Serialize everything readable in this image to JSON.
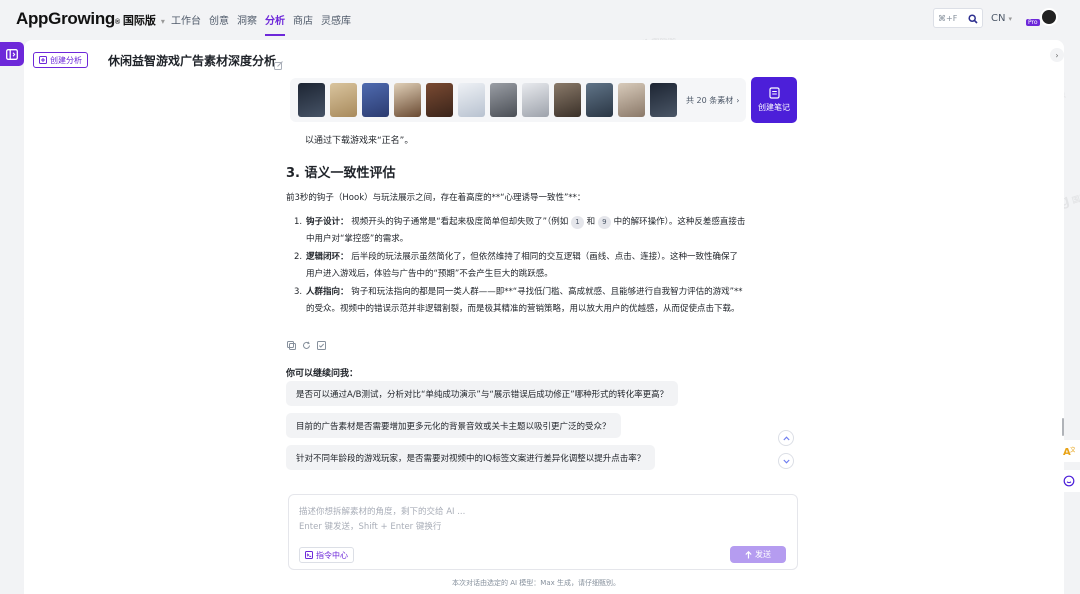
{
  "app": {
    "logo_main": "AppGrowing",
    "logo_sub": "国际版",
    "nav": [
      "工作台",
      "创意",
      "洞察",
      "分析",
      "商店",
      "灵感库"
    ],
    "active_nav": "分析",
    "shortcut": "⌘+F",
    "language": "CN",
    "plan_badge": "Pro"
  },
  "page": {
    "create_analysis": "创建分析",
    "title": "休闲益智游戏广告素材深度分析"
  },
  "media_strip": {
    "total_label": "共 20 条素材",
    "create_note": "创建笔记",
    "thumb_colors": [
      "#2f3a4a",
      "#c8b08a",
      "#3a4f8a",
      "#8a6a4a",
      "#5a3a2a",
      "#d8dde5",
      "#6a6e75",
      "#c9ccd2",
      "#5a4f46",
      "#3b4a5a",
      "#b9aa9a",
      "#2b3440"
    ]
  },
  "article": {
    "prev_line": "以通过下载游戏来“正名”。",
    "heading": "3. 语义一致性评估",
    "intro": "前3秒的钩子（Hook）与玩法展示之间，存在着高度的**“心理诱导一致性”**：",
    "items": [
      {
        "num": "1.",
        "title": "钩子设计：",
        "text_a": " 视频开头的钩子通常是“看起来极度简单但却失败了”（例如 ",
        "chip1": "1",
        "text_b": " 和 ",
        "chip2": "9",
        "text_c": " 中的解环操作）。这种反差感直接击中用户对“掌控感”的需求。"
      },
      {
        "num": "2.",
        "title": "逻辑闭环：",
        "text": " 后半段的玩法展示虽然简化了，但依然维持了相同的交互逻辑（画线、点击、连接）。这种一致性确保了用户进入游戏后，体验与广告中的“预期”不会产生巨大的跳跃感。"
      },
      {
        "num": "3.",
        "title": "人群指向：",
        "text": " 钩子和玩法指向的都是同一类人群——即**“寻找低门槛、高成就感、且能够进行自我智力评估的游戏”**的受众。视频中的错误示范并非逻辑割裂，而是极其精准的营销策略，用以放大用户的优越感，从而促使点击下载。"
      }
    ]
  },
  "followup": {
    "title": "你可以继续问我：",
    "suggestions": [
      "是否可以通过A/B测试，分析对比“单纯成功演示”与“展示错误后成功修正”哪种形式的转化率更高？",
      "目前的广告素材是否需要增加更多元化的背景音效或关卡主题以吸引更广泛的受众？",
      "针对不同年龄段的游戏玩家，是否需要对视频中的IQ标签文案进行差异化调整以提升点击率？"
    ]
  },
  "composer": {
    "placeholder_line1": "描述你想拆解素材的角度，剩下的交给 AI ...",
    "placeholder_line2": "Enter 键发送，Shift + Enter 键换行",
    "command_center": "指令中心",
    "send": "发送",
    "footnote": "本次对话由选定的 AI 模型：Max 生成，请仔细甄别。"
  },
  "colors": {
    "accent": "#6d28d9",
    "note_button": "#4c1fd9",
    "send_disabled": "#b59cf0"
  }
}
